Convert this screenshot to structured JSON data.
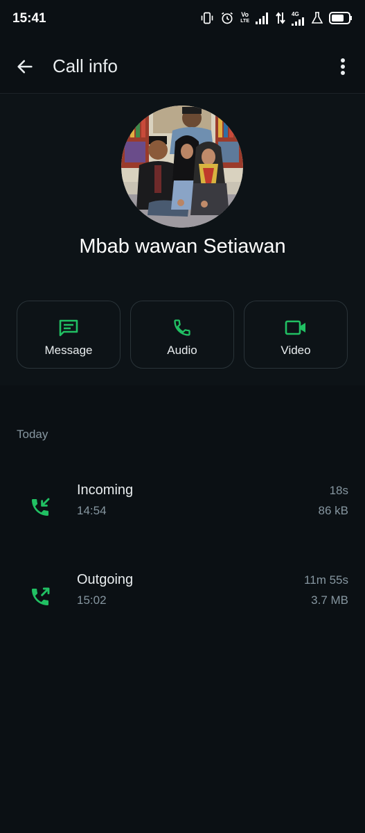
{
  "status_bar": {
    "time": "15:41",
    "volte": "Vo",
    "lte": "LTE",
    "network": "4G"
  },
  "app_bar": {
    "title": "Call info",
    "back_icon": "arrow-left-icon",
    "menu_icon": "more-vert-icon"
  },
  "contact": {
    "name": "Mbab wawan Setiawan",
    "avatar": "family-photo"
  },
  "actions": [
    {
      "label": "Message",
      "icon": "message-icon"
    },
    {
      "label": "Audio",
      "icon": "phone-icon"
    },
    {
      "label": "Video",
      "icon": "videocam-icon"
    }
  ],
  "calls_section": {
    "label": "Today",
    "calls": [
      {
        "type": "Incoming",
        "time": "14:54",
        "duration": "18s",
        "size": "86 kB",
        "icon": "call-received-icon"
      },
      {
        "type": "Outgoing",
        "time": "15:02",
        "duration": "11m 55s",
        "size": "3.7 MB",
        "icon": "call-made-icon"
      }
    ]
  },
  "colors": {
    "background": "#0b1014",
    "accent": "#21c063",
    "text_primary": "#e9edef",
    "text_secondary": "#8696a0"
  }
}
